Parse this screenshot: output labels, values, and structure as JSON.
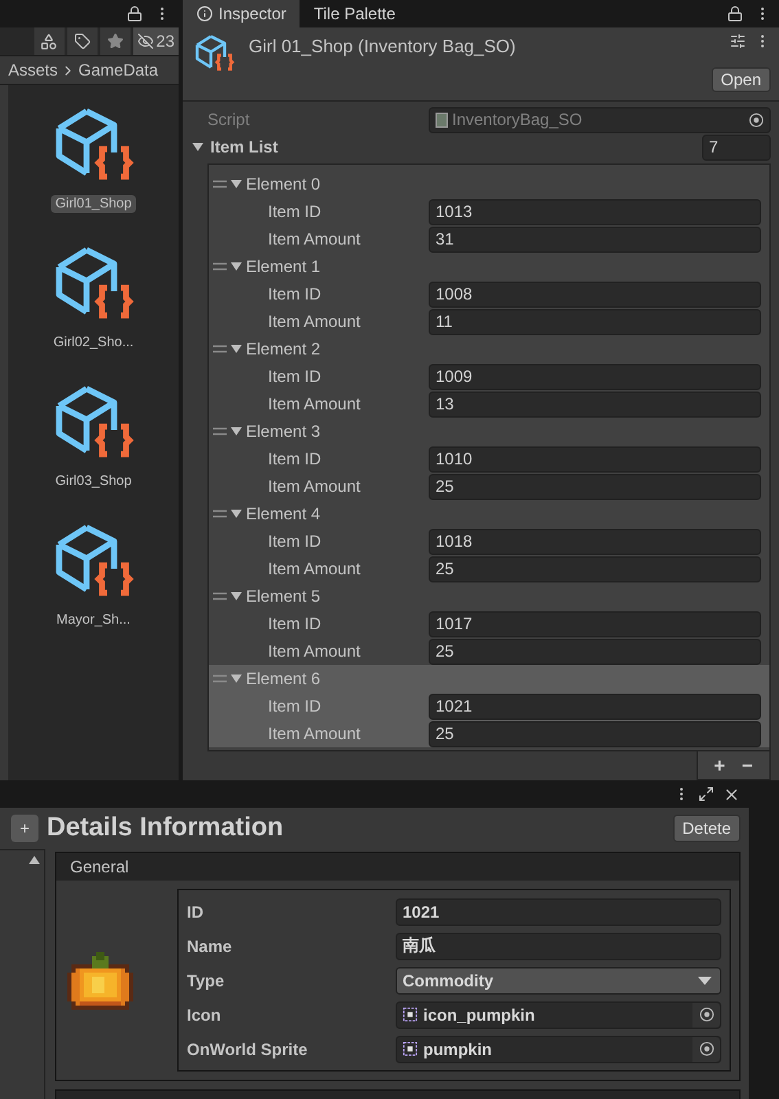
{
  "project": {
    "hidden_count": "23",
    "breadcrumb": [
      "Assets",
      "GameData"
    ],
    "assets": [
      {
        "label": "Girl01_Shop",
        "selected": true
      },
      {
        "label": "Girl02_Sho...",
        "selected": false
      },
      {
        "label": "Girl03_Shop",
        "selected": false
      },
      {
        "label": "Mayor_Sh...",
        "selected": false
      }
    ]
  },
  "inspector": {
    "tabs": [
      {
        "label": "Inspector",
        "selected": true
      },
      {
        "label": "Tile Palette",
        "selected": false
      }
    ],
    "title": "Girl 01_Shop (Inventory Bag_SO)",
    "open_button": "Open",
    "script_label": "Script",
    "script_value": "InventoryBag_SO",
    "list_label": "Item List",
    "list_expanded": true,
    "list_size": "7",
    "elements": [
      {
        "label": "Element 0",
        "expanded": true,
        "selected": false,
        "fields": [
          {
            "label": "Item ID",
            "value": "1013"
          },
          {
            "label": "Item Amount",
            "value": "31"
          }
        ]
      },
      {
        "label": "Element 1",
        "expanded": true,
        "selected": false,
        "fields": [
          {
            "label": "Item ID",
            "value": "1008"
          },
          {
            "label": "Item Amount",
            "value": "11"
          }
        ]
      },
      {
        "label": "Element 2",
        "expanded": true,
        "selected": false,
        "fields": [
          {
            "label": "Item ID",
            "value": "1009"
          },
          {
            "label": "Item Amount",
            "value": "13"
          }
        ]
      },
      {
        "label": "Element 3",
        "expanded": true,
        "selected": false,
        "fields": [
          {
            "label": "Item ID",
            "value": "1010"
          },
          {
            "label": "Item Amount",
            "value": "25"
          }
        ]
      },
      {
        "label": "Element 4",
        "expanded": true,
        "selected": false,
        "fields": [
          {
            "label": "Item ID",
            "value": "1018"
          },
          {
            "label": "Item Amount",
            "value": "25"
          }
        ]
      },
      {
        "label": "Element 5",
        "expanded": true,
        "selected": false,
        "fields": [
          {
            "label": "Item ID",
            "value": "1017"
          },
          {
            "label": "Item Amount",
            "value": "25"
          }
        ]
      },
      {
        "label": "Element 6",
        "expanded": true,
        "selected": true,
        "fields": [
          {
            "label": "Item ID",
            "value": "1021"
          },
          {
            "label": "Item Amount",
            "value": "25"
          }
        ]
      }
    ],
    "add_button": "+",
    "remove_button": "−"
  },
  "details": {
    "add_button": "+",
    "title": "Details Information",
    "delete_button": "Detete",
    "section": "General",
    "fields": [
      {
        "kind": "text",
        "label": "ID",
        "value": "1021"
      },
      {
        "kind": "text",
        "label": "Name",
        "value": "南瓜"
      },
      {
        "kind": "dropdown",
        "label": "Type",
        "value": "Commodity"
      },
      {
        "kind": "object",
        "label": "Icon",
        "value": "icon_pumpkin"
      },
      {
        "kind": "object",
        "label": "OnWorld Sprite",
        "value": "pumpkin"
      }
    ]
  }
}
